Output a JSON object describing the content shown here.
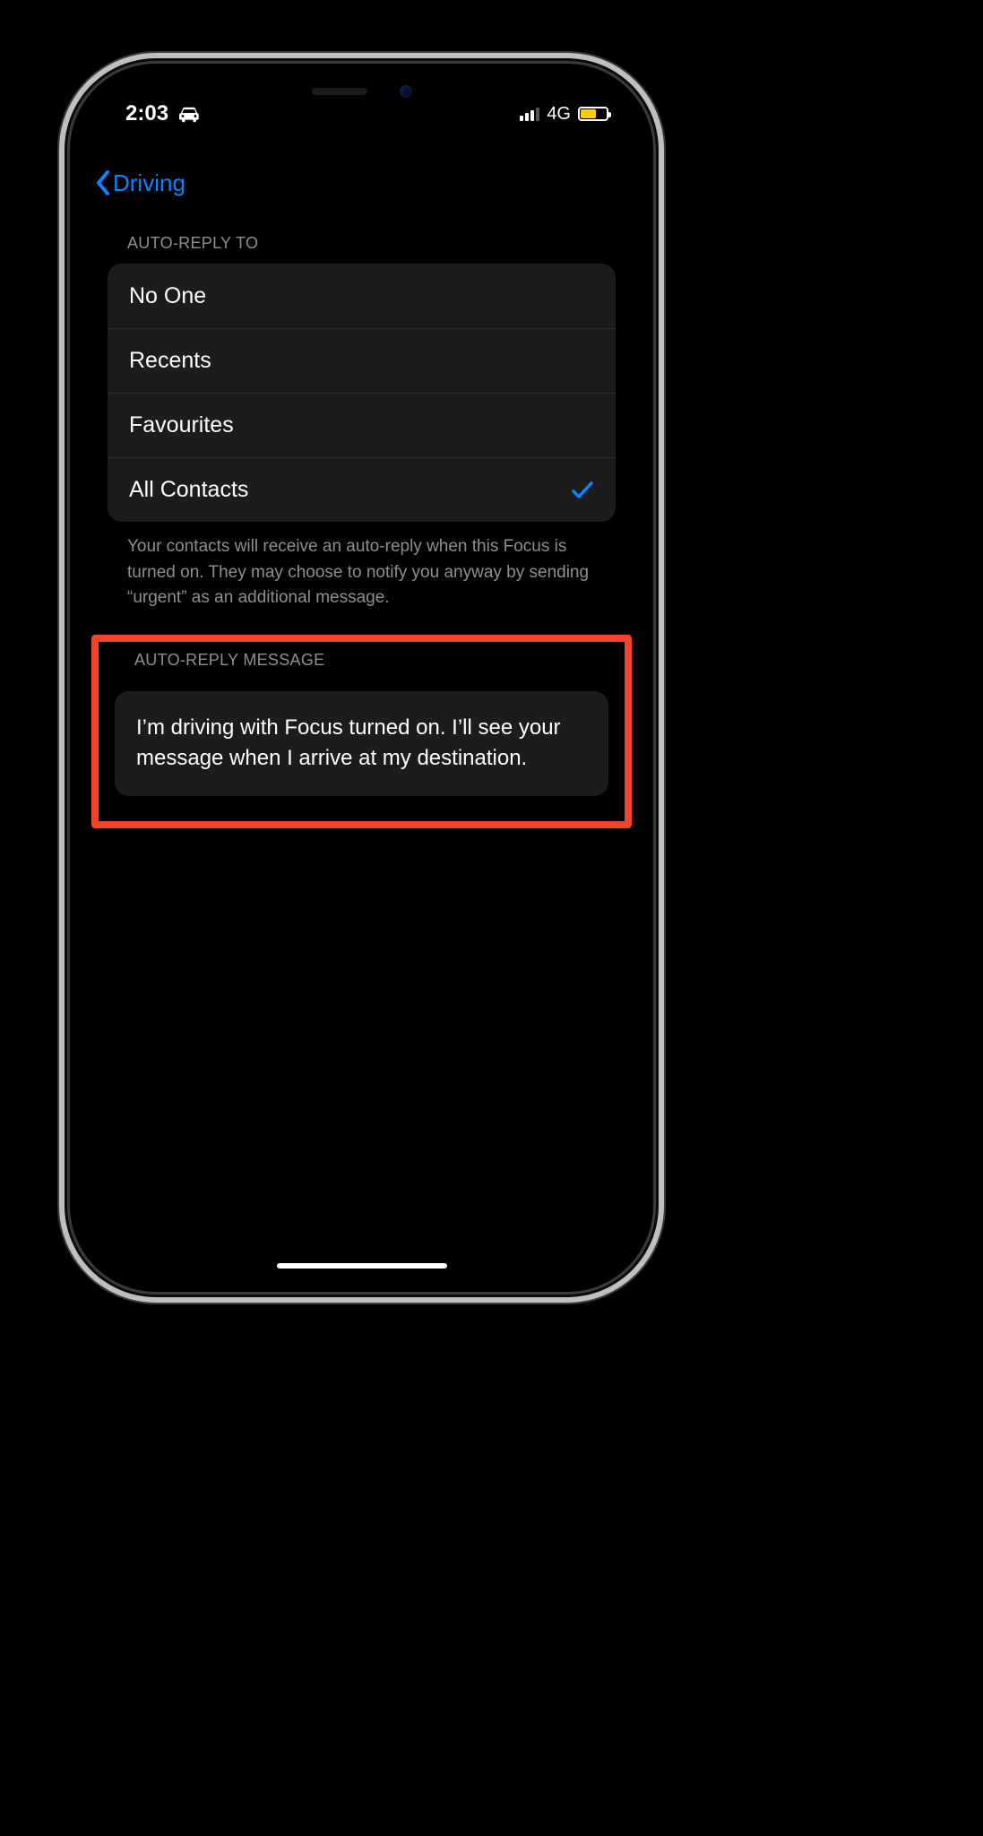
{
  "status": {
    "time": "2:03",
    "network_label": "4G"
  },
  "nav": {
    "back_label": "Driving"
  },
  "sections": {
    "auto_reply_to": {
      "header": "AUTO-REPLY TO",
      "options": {
        "no_one": "No One",
        "recents": "Recents",
        "favourites": "Favourites",
        "all_contacts": "All Contacts"
      },
      "selected": "all_contacts",
      "footer": "Your contacts will receive an auto-reply when this Focus is turned on. They may choose to notify you anyway by sending “urgent” as an additional message."
    },
    "auto_reply_message": {
      "header": "AUTO-REPLY MESSAGE",
      "message": "I’m driving with Focus turned on. I’ll see your message when I arrive at my destination."
    }
  }
}
